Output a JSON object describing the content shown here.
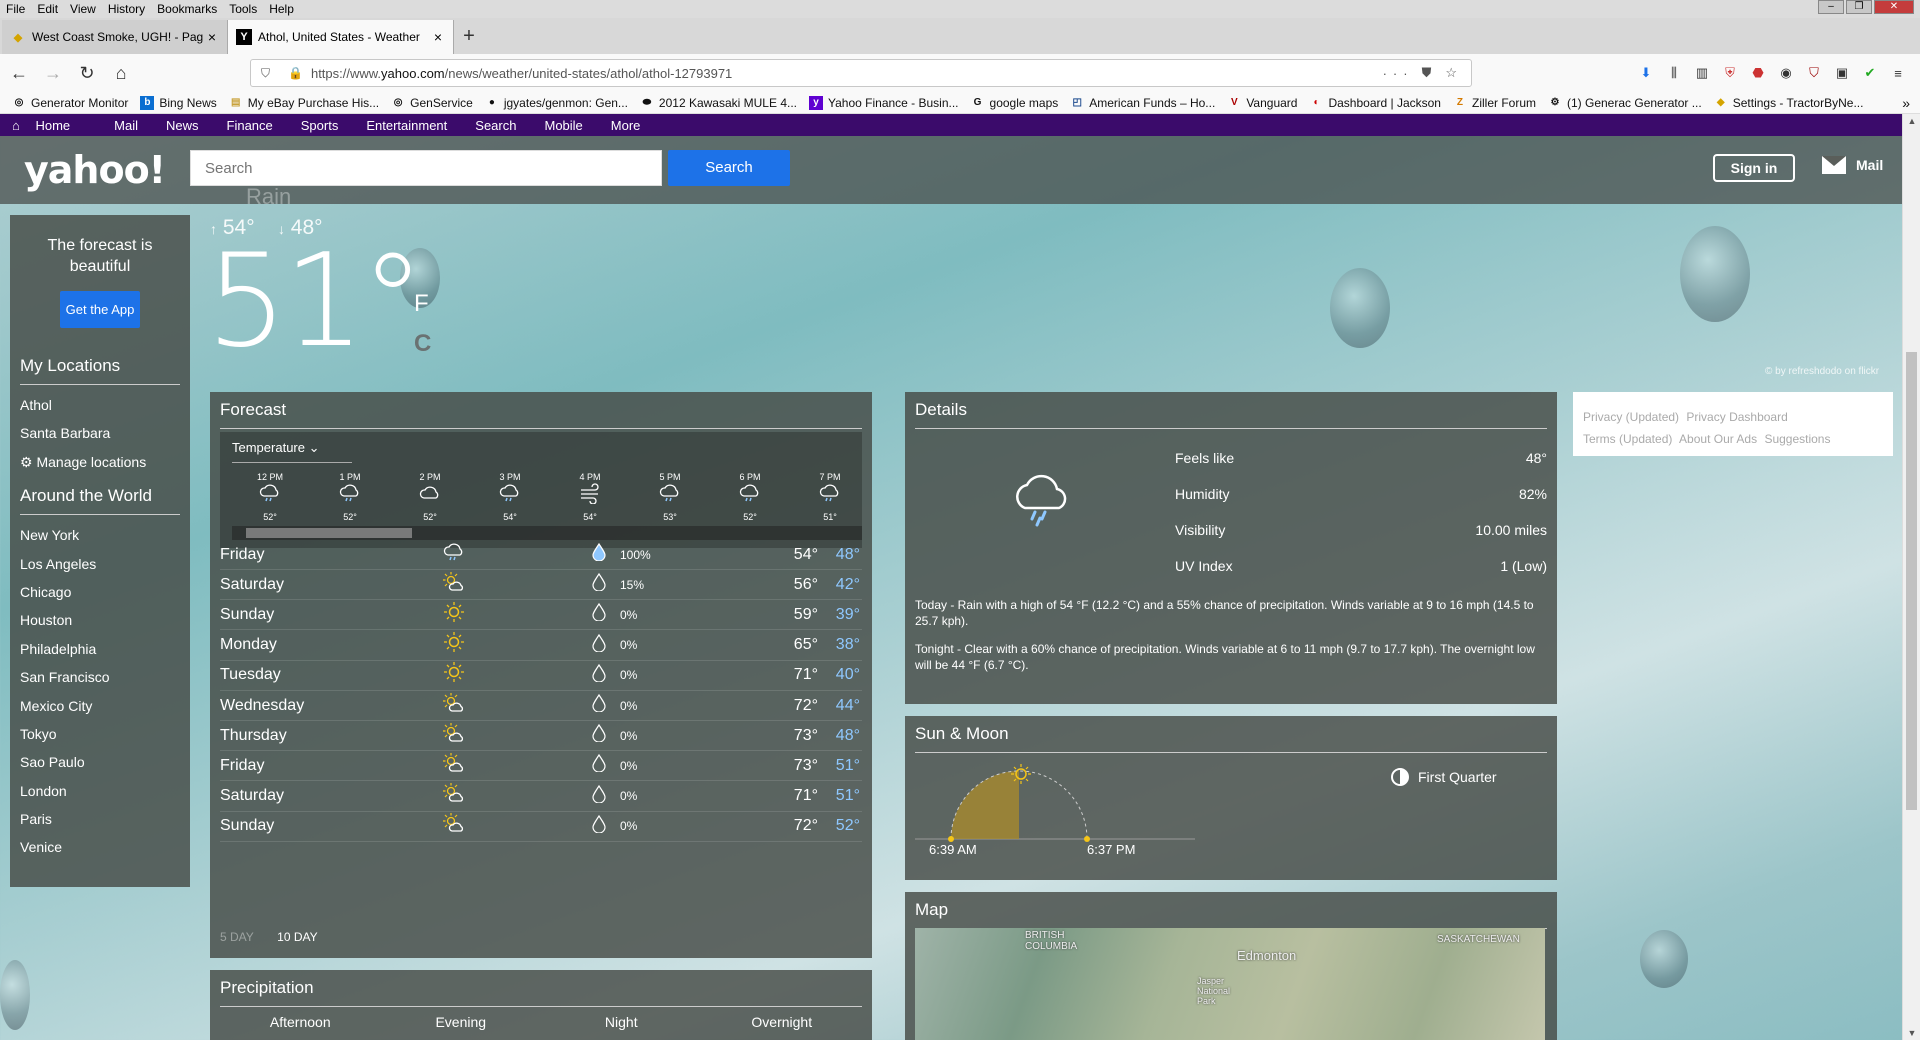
{
  "browser": {
    "menu": [
      "File",
      "Edit",
      "View",
      "History",
      "Bookmarks",
      "Tools",
      "Help"
    ],
    "tabs": [
      {
        "title": "West Coast Smoke, UGH! - Pag",
        "icon": "generator-icon",
        "active": false
      },
      {
        "title": "Athol, United States - Weather",
        "icon": "yahoo-icon",
        "active": true
      }
    ],
    "url_prefix": "https://www.",
    "url_domain": "yahoo.com",
    "url_path": "/news/weather/united-states/athol/athol-12793971",
    "bookmarks": [
      "Generator Monitor",
      "Bing News",
      "My eBay Purchase His...",
      "GenService",
      "jgyates/genmon: Gen...",
      "2012 Kawasaki MULE 4...",
      "Yahoo Finance - Busin...",
      "google maps",
      "American Funds – Ho...",
      "Vanguard",
      "Dashboard | Jackson",
      "Ziller Forum",
      "(1) Generac Generator ...",
      "Settings - TractorByNe..."
    ]
  },
  "yahoo_nav": [
    "Home",
    "Mail",
    "News",
    "Finance",
    "Sports",
    "Entertainment",
    "Search",
    "Mobile",
    "More"
  ],
  "header": {
    "logo": "yahoo!",
    "search_placeholder": "Search",
    "search_button": "Search",
    "sign_in": "Sign in",
    "mail": "Mail"
  },
  "sidebar": {
    "promo": "The forecast is beautiful",
    "get_app": "Get the App",
    "my_locations_title": "My Locations",
    "my_locations": [
      "Athol",
      "Santa Barbara",
      "Manage locations"
    ],
    "world_title": "Around the World",
    "world": [
      "New York",
      "Los Angeles",
      "Chicago",
      "Houston",
      "Philadelphia",
      "San Francisco",
      "Mexico City",
      "Tokyo",
      "Sao Paulo",
      "London",
      "Paris",
      "Venice"
    ]
  },
  "current": {
    "condition": "Rain",
    "high": "54°",
    "low": "48°",
    "temp": "51°",
    "unit_f": "F",
    "unit_c": "C",
    "photo_credit": "© by refreshdodo on flickr"
  },
  "forecast": {
    "title": "Forecast",
    "selector": "Temperature",
    "hourly": [
      {
        "time": "12 PM",
        "icon": "rain-cloud-icon",
        "temp": "52°"
      },
      {
        "time": "1 PM",
        "icon": "rain-cloud-icon",
        "temp": "52°"
      },
      {
        "time": "2 PM",
        "icon": "cloud-icon",
        "temp": "52°"
      },
      {
        "time": "3 PM",
        "icon": "rain-cloud-icon",
        "temp": "54°"
      },
      {
        "time": "4 PM",
        "icon": "wind-icon",
        "temp": "54°"
      },
      {
        "time": "5 PM",
        "icon": "rain-cloud-icon",
        "temp": "53°"
      },
      {
        "time": "6 PM",
        "icon": "rain-cloud-icon",
        "temp": "52°"
      },
      {
        "time": "7 PM",
        "icon": "rain-cloud-icon",
        "temp": "51°"
      }
    ],
    "daily": [
      {
        "day": "Friday",
        "icon": "rain-cloud-icon",
        "precip": "100%",
        "hi": "54°",
        "lo": "48°"
      },
      {
        "day": "Saturday",
        "icon": "partly-cloudy-icon",
        "precip": "15%",
        "hi": "56°",
        "lo": "42°"
      },
      {
        "day": "Sunday",
        "icon": "sun-icon",
        "precip": "0%",
        "hi": "59°",
        "lo": "39°"
      },
      {
        "day": "Monday",
        "icon": "sun-icon",
        "precip": "0%",
        "hi": "65°",
        "lo": "38°"
      },
      {
        "day": "Tuesday",
        "icon": "sun-icon",
        "precip": "0%",
        "hi": "71°",
        "lo": "40°"
      },
      {
        "day": "Wednesday",
        "icon": "partly-cloudy-icon",
        "precip": "0%",
        "hi": "72°",
        "lo": "44°"
      },
      {
        "day": "Thursday",
        "icon": "partly-cloudy-icon",
        "precip": "0%",
        "hi": "73°",
        "lo": "48°"
      },
      {
        "day": "Friday",
        "icon": "partly-cloudy-icon",
        "precip": "0%",
        "hi": "73°",
        "lo": "51°"
      },
      {
        "day": "Saturday",
        "icon": "partly-cloudy-icon",
        "precip": "0%",
        "hi": "71°",
        "lo": "51°"
      },
      {
        "day": "Sunday",
        "icon": "partly-cloudy-icon",
        "precip": "0%",
        "hi": "72°",
        "lo": "52°"
      }
    ],
    "toggle_5day": "5 DAY",
    "toggle_10day": "10 DAY"
  },
  "details": {
    "title": "Details",
    "rows": [
      {
        "label": "Feels like",
        "value": "48°"
      },
      {
        "label": "Humidity",
        "value": "82%"
      },
      {
        "label": "Visibility",
        "value": "10.00 miles"
      },
      {
        "label": "UV Index",
        "value": "1 (Low)"
      }
    ],
    "today": "Today - Rain with a high of 54 °F (12.2 °C) and a 55% chance of precipitation. Winds variable at 9 to 16 mph (14.5 to 25.7 kph).",
    "tonight": "Tonight - Clear with a 60% chance of precipitation. Winds variable at 6 to 11 mph (9.7 to 17.7 kph). The overnight low will be 44 °F (6.7 °C)."
  },
  "sun_moon": {
    "title": "Sun & Moon",
    "sunrise": "6:39 AM",
    "sunset": "6:37 PM",
    "moon_phase": "First Quarter"
  },
  "map": {
    "title": "Map",
    "labels": [
      "BRITISH COLUMBIA",
      "Edmonton",
      "SASKATCHEWAN",
      "Jasper National Park"
    ]
  },
  "precipitation": {
    "title": "Precipitation",
    "tabs": [
      "Afternoon",
      "Evening",
      "Night",
      "Overnight"
    ]
  },
  "footer_links": [
    "Privacy (Updated)",
    "Privacy Dashboard",
    "Terms (Updated)",
    "About Our Ads",
    "Suggestions"
  ]
}
